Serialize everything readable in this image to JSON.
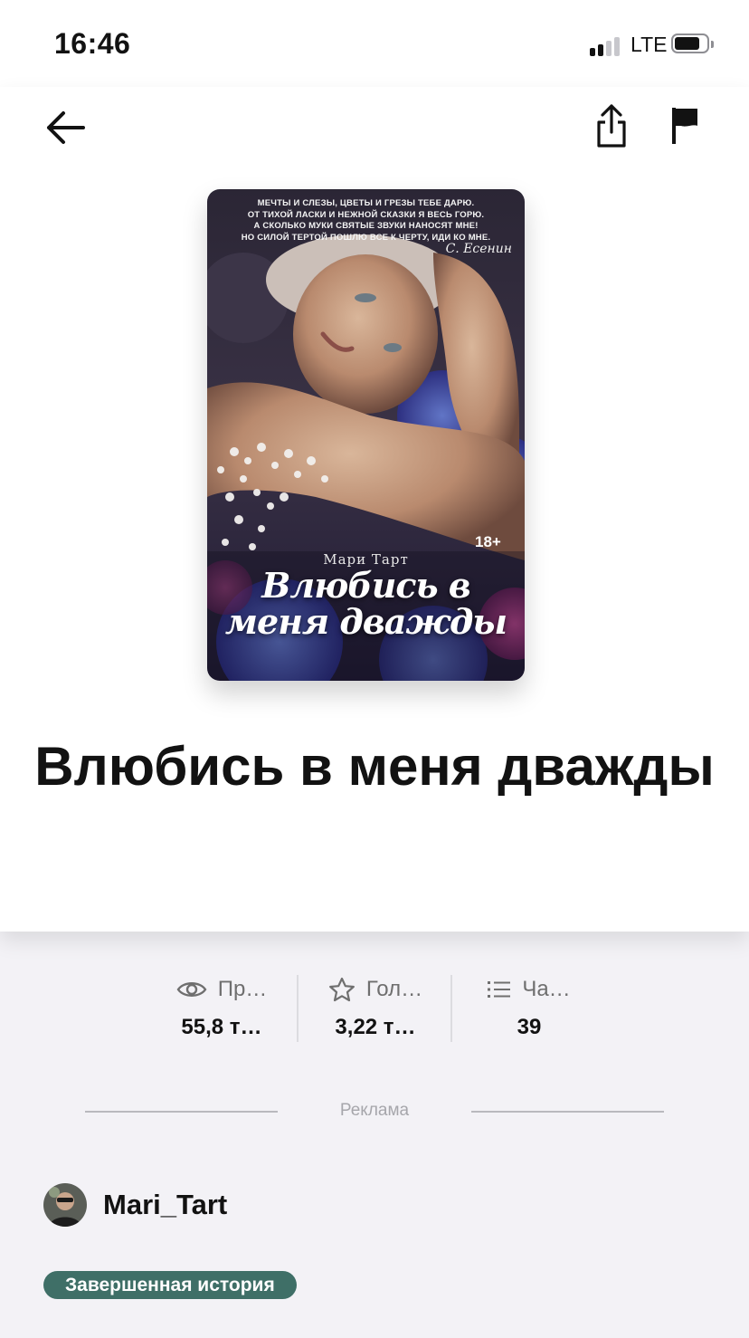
{
  "status_bar": {
    "time": "16:46",
    "network": "LTE",
    "signal_bars_active": 2,
    "signal_bars_total": 4,
    "battery_level": 0.8
  },
  "toolbar": {
    "back_icon": "arrow-left-icon",
    "share_icon": "share-icon",
    "report_icon": "flag-icon"
  },
  "cover": {
    "quote": "Мечты и слезы, цветы и грезы тебе дарю.\nОт тихой ласки и нежной сказки я весь горю.\nА сколько муки святые звуки наносят мне!\nНо силой тертой пошлю все к черту, иди ко мне.",
    "quote_author": "С. Есенин",
    "age_rating": "18+",
    "author": "Мари Тарт",
    "title": "Влюбись в меня дважды"
  },
  "book": {
    "title": "Влюбись в меня дважды"
  },
  "stats": [
    {
      "icon": "eye-icon",
      "label": "Пр…",
      "value": "55,8 т…"
    },
    {
      "icon": "star-icon",
      "label": "Гол…",
      "value": "3,22 т…"
    },
    {
      "icon": "list-icon",
      "label": "Ча…",
      "value": "39"
    }
  ],
  "ad": {
    "label": "Реклама"
  },
  "author": {
    "name": "Mari_Tart",
    "avatar_icon": "avatar"
  },
  "badge": {
    "label": "Завершенная история",
    "color": "#3f6f67"
  }
}
